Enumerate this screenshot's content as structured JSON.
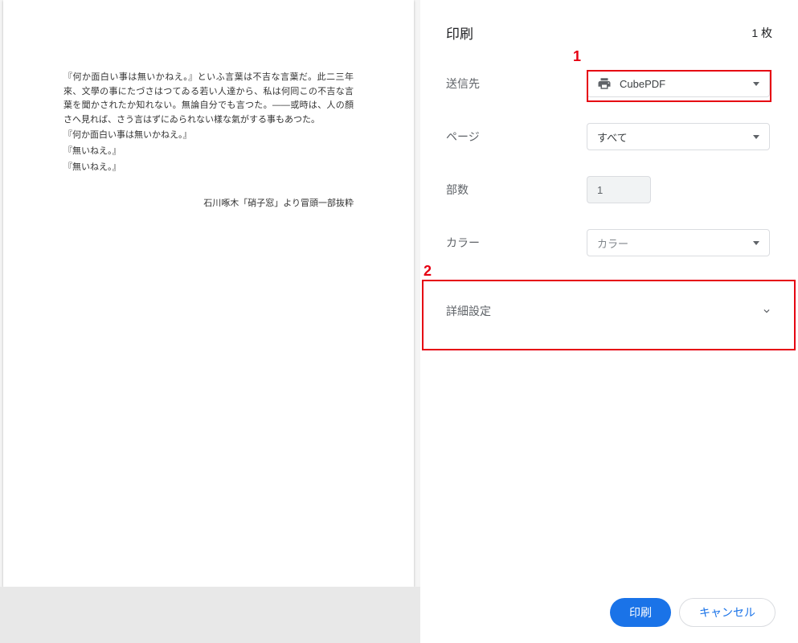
{
  "preview": {
    "paragraph1": "『何か面白い事は無いかねえ。』といふ言葉は不吉な言葉だ。此二三年來、文學の事にたづさはつてゐる若い人達から、私は何囘この不吉な言葉を聞かされたか知れない。無論自分でも言つた。――或時は、人の顏さへ見れば、さう言はずにゐられない樣な氣がする事もあつた。",
    "line2": "『何か面白い事は無いかねえ。』",
    "line3": "『無いねえ。』",
    "line4": "『無いねえ。』",
    "attribution": "石川啄木「硝子窓」より冒頭一部抜粋"
  },
  "dialog": {
    "title": "印刷",
    "page_count": "1 枚",
    "destination_label": "送信先",
    "destination_value": "CubePDF",
    "pages_label": "ページ",
    "pages_value": "すべて",
    "copies_label": "部数",
    "copies_value": "1",
    "color_label": "カラー",
    "color_value": "カラー",
    "advanced_label": "詳細設定",
    "print_button": "印刷",
    "cancel_button": "キャンセル"
  },
  "annotations": {
    "marker1": "1",
    "marker2": "2"
  }
}
